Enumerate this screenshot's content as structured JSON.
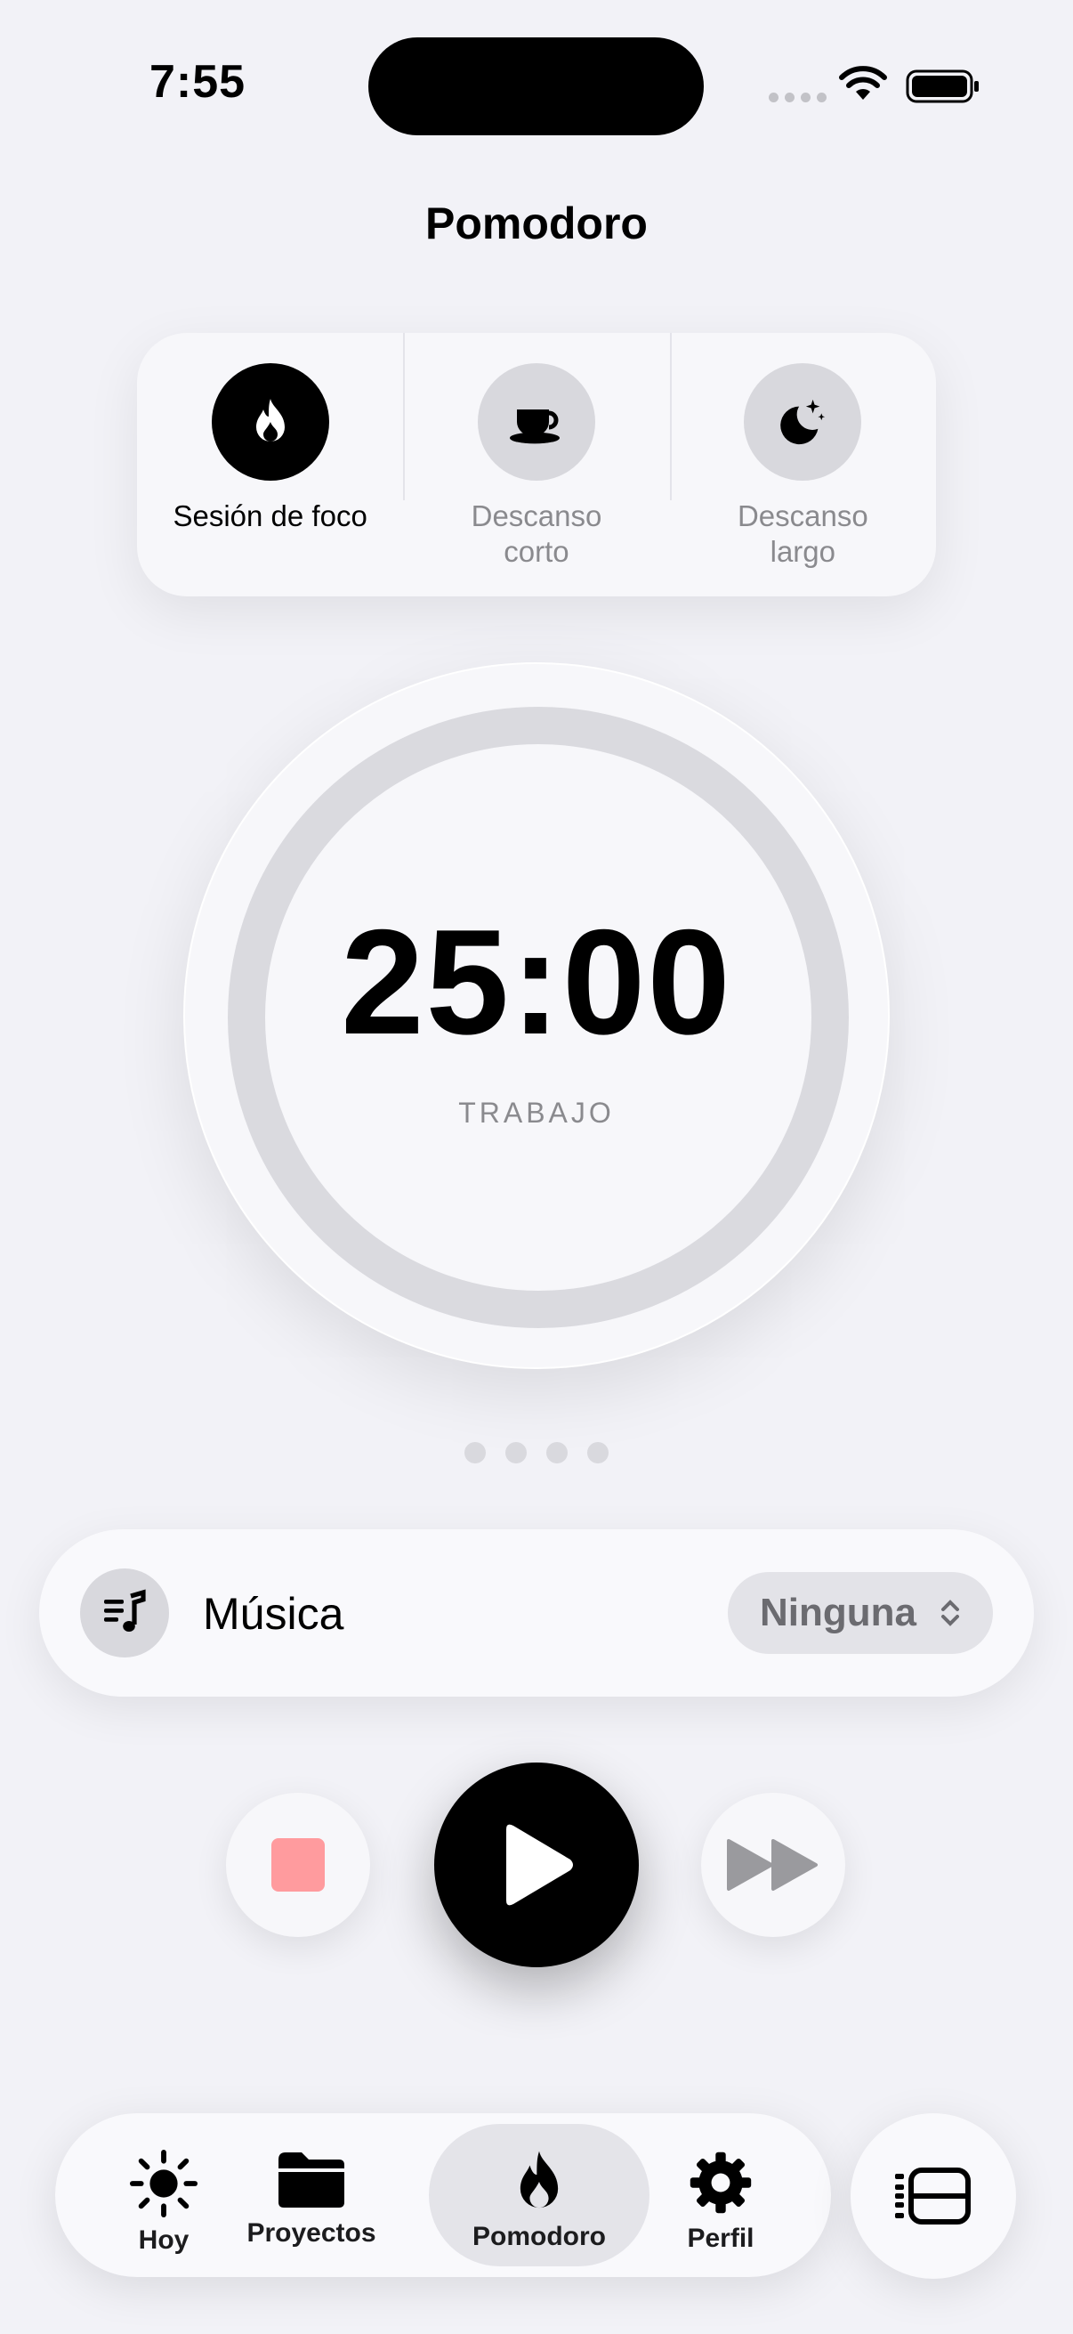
{
  "status_bar": {
    "time": "7:55"
  },
  "header": {
    "title": "Pomodoro"
  },
  "modes": [
    {
      "label": "Sesión de foco",
      "icon": "flame-icon",
      "active": true
    },
    {
      "label": "Descanso corto",
      "icon": "coffee-cup-icon",
      "active": false
    },
    {
      "label": "Descanso largo",
      "icon": "moon-stars-icon",
      "active": false
    }
  ],
  "timer": {
    "value": "25:00",
    "caption": "TRABAJO",
    "progress": 0
  },
  "sessions": {
    "total": 4,
    "completed": 0
  },
  "music": {
    "label": "Música",
    "selected": "Ninguna",
    "icon": "music-list-icon"
  },
  "controls": {
    "stop_icon": "stop-icon",
    "play_icon": "play-icon",
    "skip_icon": "skip-forward-icon",
    "stop_color": "#ff9b9e"
  },
  "tab_bar": {
    "items": [
      {
        "label": "Hoy",
        "icon": "sun-icon"
      },
      {
        "label": "Proyectos",
        "icon": "folder-icon"
      },
      {
        "label": "Pomodoro",
        "icon": "flame-icon",
        "active": true
      },
      {
        "label": "Perfil",
        "icon": "gear-icon"
      }
    ],
    "side_button_icon": "sidebar-list-icon"
  }
}
